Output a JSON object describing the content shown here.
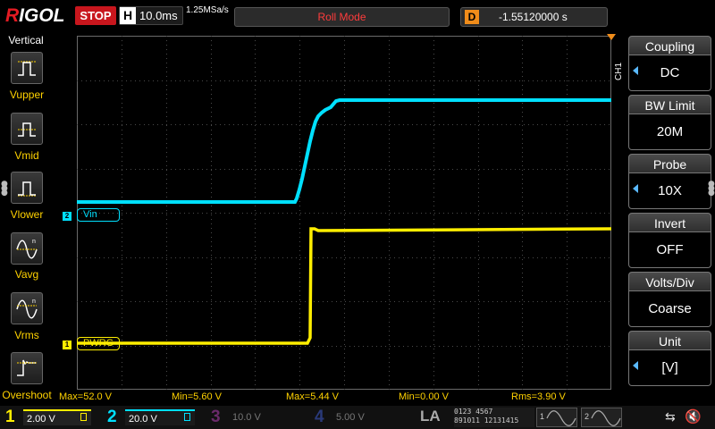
{
  "topbar": {
    "brand": "RIGOL",
    "run_state": "STOP",
    "horizontal_label": "H",
    "timebase": "10.0ms",
    "sample_rate": "1.25MSa/s",
    "mode": "Roll Mode",
    "delay_label": "D",
    "delay": "-1.55120000 s"
  },
  "left_menu": {
    "title": "Vertical",
    "items": [
      {
        "label": "Vupper",
        "icon": "vupper-icon"
      },
      {
        "label": "Vmid",
        "icon": "vmid-icon"
      },
      {
        "label": "Vlower",
        "icon": "vlower-icon"
      },
      {
        "label": "Vavg",
        "icon": "vavg-icon"
      },
      {
        "label": "Vrms",
        "icon": "vrms-icon"
      },
      {
        "label": "Overshoot",
        "icon": "overshoot-icon"
      }
    ]
  },
  "channel_tags": {
    "ch2": {
      "num": "2",
      "label": "Vin"
    },
    "ch1": {
      "num": "1",
      "label": "PWRG"
    }
  },
  "right_menu": {
    "channel": "CH1",
    "items": [
      {
        "title": "Coupling",
        "value": "DC",
        "arrow": true
      },
      {
        "title": "BW Limit",
        "value": "20M",
        "arrow": false
      },
      {
        "title": "Probe",
        "value": "10X",
        "arrow": true
      },
      {
        "title": "Invert",
        "value": "OFF",
        "arrow": false
      },
      {
        "title": "Volts/Div",
        "value": "Coarse",
        "arrow": false
      },
      {
        "title": "Unit",
        "value": "[V]",
        "arrow": true
      }
    ]
  },
  "measurements": [
    "Max=52.0 V",
    "Min=5.60 V",
    "Max=5.44 V",
    "Min=0.00 V",
    "Rms=3.90 V"
  ],
  "channels_bar": [
    {
      "num": "1",
      "scale": "2.00 V",
      "color": "#ffee00",
      "active": true
    },
    {
      "num": "2",
      "scale": "20.0 V",
      "color": "#00e0ff",
      "active": true
    },
    {
      "num": "3",
      "scale": "10.0 V",
      "color": "#c81ec8",
      "active": false
    },
    {
      "num": "4",
      "scale": "5.00 V",
      "color": "#3c64ff",
      "active": false
    }
  ],
  "la_label": "LA",
  "la_bits": [
    "0123",
    "4567",
    "891011",
    "12131415"
  ],
  "generators": [
    "1",
    "2"
  ],
  "colors": {
    "ch1": "#ffee00",
    "ch2": "#00e0ff",
    "accent": "#f08c1a",
    "stop": "#c8161d"
  }
}
